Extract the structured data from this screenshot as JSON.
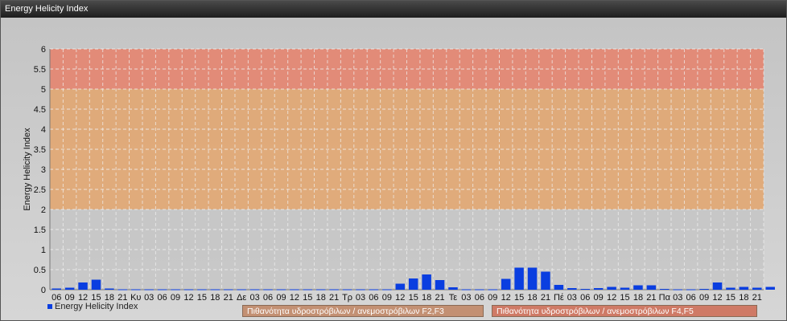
{
  "window": {
    "title": "Energy Helicity Index"
  },
  "colors": {
    "bar": "#0a3ee0",
    "zone_low": "#c6c6c6",
    "zone_mid": "#e3a46c",
    "zone_high": "#e6806a",
    "badge_mid": "#c39073",
    "badge_high": "#cf7a66"
  },
  "legend": {
    "label": "Energy Helicity Index"
  },
  "badges": [
    {
      "label": "Πιθανότητα υδροστρόβιλων / ανεμοστρόβιλων F2,F3"
    },
    {
      "label": "Πιθανότητα υδροστρόβιλων / ανεμοστρόβιλων F4,F5"
    }
  ],
  "chart_data": {
    "type": "bar",
    "title": "",
    "xlabel": "",
    "ylabel": "Energy Helicity Index",
    "ylim": [
      0,
      6
    ],
    "yticks": [
      0,
      0.5,
      1,
      1.5,
      2,
      2.5,
      3,
      3.5,
      4,
      4.5,
      5,
      5.5,
      6
    ],
    "grid": true,
    "legend_position": "bottom-left",
    "zones": [
      {
        "from": 0,
        "to": 2,
        "color": "#c6c6c6"
      },
      {
        "from": 2,
        "to": 5,
        "color": "#e3a46c"
      },
      {
        "from": 5,
        "to": 6,
        "color": "#e6806a"
      }
    ],
    "categories": [
      "06",
      "09",
      "12",
      "15",
      "18",
      "21",
      "Κυ",
      "03",
      "06",
      "09",
      "12",
      "15",
      "18",
      "21",
      "Δε",
      "03",
      "06",
      "09",
      "12",
      "15",
      "18",
      "21",
      "Τρ",
      "03",
      "06",
      "09",
      "12",
      "15",
      "18",
      "21",
      "Τε",
      "03",
      "06",
      "09",
      "12",
      "15",
      "18",
      "21",
      "Πέ",
      "03",
      "06",
      "09",
      "12",
      "15",
      "18",
      "21",
      "Πα",
      "03",
      "06",
      "09",
      "12",
      "15",
      "18",
      "21"
    ],
    "series": [
      {
        "name": "Energy Helicity Index",
        "values": [
          0.03,
          0.05,
          0.18,
          0.25,
          0.03,
          0.01,
          0.01,
          0.01,
          0.01,
          0.01,
          0.01,
          0.01,
          0.01,
          0.01,
          0.01,
          0.01,
          0.01,
          0.01,
          0.01,
          0.01,
          0.01,
          0.01,
          0.01,
          0.01,
          0.01,
          0.01,
          0.15,
          0.28,
          0.38,
          0.24,
          0.06,
          0.01,
          0.01,
          0.01,
          0.27,
          0.55,
          0.55,
          0.45,
          0.12,
          0.04,
          0.02,
          0.04,
          0.07,
          0.05,
          0.11,
          0.11,
          0.02,
          0.01,
          0.01,
          0.02,
          0.18,
          0.05,
          0.07,
          0.05,
          0.07
        ]
      }
    ]
  }
}
